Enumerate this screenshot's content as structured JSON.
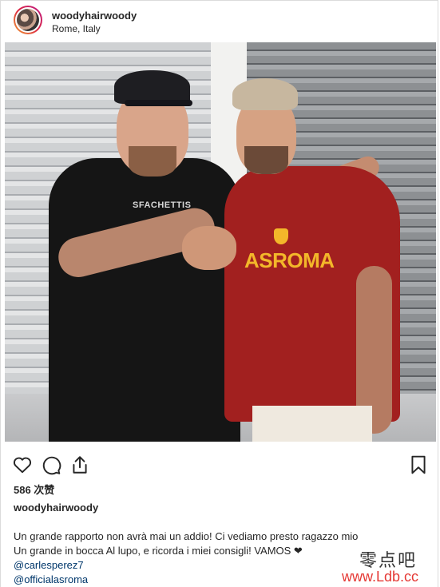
{
  "header": {
    "username": "woodyhairwoody",
    "location": "Rome, Italy"
  },
  "photo": {
    "shirt_text": "ASROMA",
    "tee_logo": "SFACHETTIS"
  },
  "actions": {
    "icons": [
      "heart-icon",
      "comment-icon",
      "share-icon",
      "bookmark-icon"
    ]
  },
  "likes": {
    "count_text": "586 次赞"
  },
  "caption": {
    "username": "woodyhairwoody",
    "line1": "Un grande rapporto non avrà mai un addio! Ci vediamo presto ragazzo mio",
    "line2": "Un grande in bocca Al lupo, e ricorda i miei consigli! VAMOS ❤",
    "mention1": "@carlesperez7",
    "mention2": "@officialasroma"
  },
  "watermark": {
    "cn": "零点吧",
    "url": "www.Ldb.cc"
  },
  "colors": {
    "jersey_red": "#a2201f",
    "roma_yellow": "#f3b72a",
    "mention_blue": "#00376b",
    "watermark_red": "#e53935"
  }
}
